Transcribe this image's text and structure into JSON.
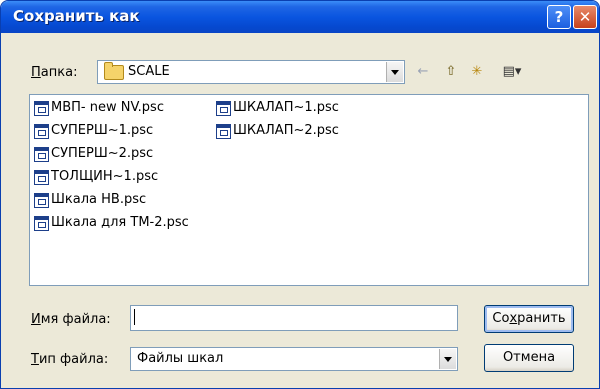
{
  "window": {
    "title": "Сохранить как",
    "help_glyph": "?",
    "close_glyph": "✕"
  },
  "toolbar": {
    "folder_label_pre": "",
    "folder_label_underlined": "П",
    "folder_label_rest": "апка:",
    "folder_value": "SCALE",
    "back_icon_glyph": "←",
    "up_icon_glyph": "⇧",
    "new_folder_glyph": "✳",
    "view_menu_glyph": "▤▾"
  },
  "files": {
    "column1": [
      "МВП- new NV.psc",
      "СУПЕРШ~1.psc",
      "СУПЕРШ~2.psc",
      "ТОЛЩИН~1.psc",
      "Шкала HB.psc",
      "Шкала для ТМ-2.psc"
    ],
    "column2": [
      "ШКАЛАП~1.psc",
      "ШКАЛАП~2.psc"
    ]
  },
  "filename": {
    "label_underlined": "И",
    "label_rest": "мя файла:",
    "value": ""
  },
  "filetype": {
    "label_underlined": "Т",
    "label_rest": "ип файла:",
    "value": "Файлы шкал"
  },
  "buttons": {
    "save_pre": "Со",
    "save_underlined": "х",
    "save_rest": "ранить",
    "cancel": "Отмена"
  }
}
